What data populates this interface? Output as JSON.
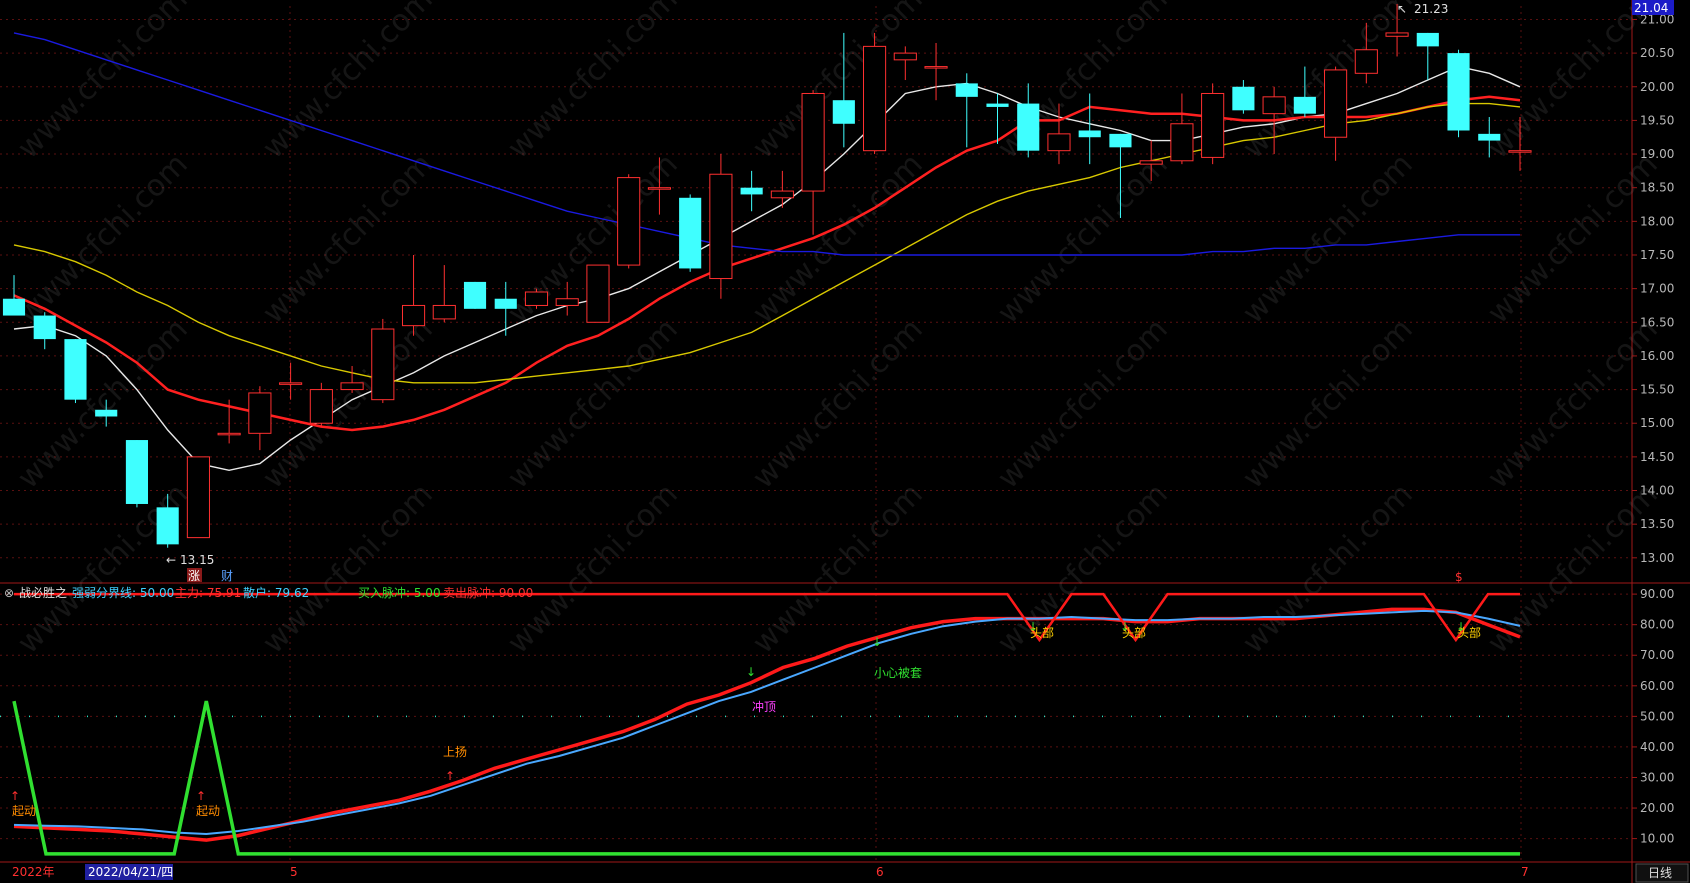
{
  "watermark": "www.cfchi.com",
  "price_right_badge": "21.04",
  "high_marker": "21.23",
  "low_marker": "13.15",
  "price_markers": [
    "涨",
    "财"
  ],
  "indicator_header": {
    "name": "战必胜之",
    "fields": [
      {
        "label": "强弱分界线: 50.00",
        "color": "#40d0ff"
      },
      {
        "label": "主力: 75.91",
        "color": "#ff3030"
      },
      {
        "label": "散户: 79.62",
        "color": "#40d0ff"
      },
      {
        "label": "买入脉冲: 5.00",
        "color": "#30e030"
      },
      {
        "label": "卖出脉冲: 90.00",
        "color": "#ff3030"
      }
    ]
  },
  "signal_labels": [
    {
      "text": "起动",
      "color": "#ff8c00"
    },
    {
      "text": "起动",
      "color": "#ff8c00"
    },
    {
      "text": "上扬",
      "color": "#ff8c00"
    },
    {
      "text": "冲顶",
      "color": "#ff40ff"
    },
    {
      "text": "小心被套",
      "color": "#30e030"
    },
    {
      "text": "头部",
      "color": "#ffd000"
    },
    {
      "text": "头部",
      "color": "#ffd000"
    },
    {
      "text": "头部",
      "color": "#ffd000"
    }
  ],
  "dollar_marker": "$",
  "x_axis": {
    "labels": [
      "2022年",
      "2022/04/21/四",
      "5",
      "6",
      "7"
    ],
    "period_button": "日线"
  },
  "chart_data": [
    {
      "type": "candlestick",
      "ylim": [
        12.7,
        21.2
      ],
      "y_ticks": [
        "21.00",
        "20.50",
        "20.00",
        "19.50",
        "19.00",
        "18.50",
        "18.00",
        "17.50",
        "17.00",
        "16.50",
        "16.00",
        "15.50",
        "15.00",
        "14.50",
        "14.00",
        "13.50",
        "13.00"
      ],
      "candles": [
        {
          "o": 16.85,
          "h": 17.2,
          "l": 16.6,
          "c": 16.6
        },
        {
          "o": 16.6,
          "h": 16.65,
          "l": 16.1,
          "c": 16.25
        },
        {
          "o": 16.25,
          "h": 16.25,
          "l": 15.3,
          "c": 15.35
        },
        {
          "o": 15.2,
          "h": 15.35,
          "l": 14.95,
          "c": 15.1
        },
        {
          "o": 14.75,
          "h": 14.75,
          "l": 13.75,
          "c": 13.8
        },
        {
          "o": 13.75,
          "h": 13.95,
          "l": 13.15,
          "c": 13.2
        },
        {
          "o": 13.3,
          "h": 14.5,
          "l": 13.3,
          "c": 14.5
        },
        {
          "o": 14.85,
          "h": 15.35,
          "l": 14.7,
          "c": 14.85
        },
        {
          "o": 14.85,
          "h": 15.55,
          "l": 14.6,
          "c": 15.45
        },
        {
          "o": 15.6,
          "h": 15.9,
          "l": 15.35,
          "c": 15.6
        },
        {
          "o": 15.0,
          "h": 15.6,
          "l": 14.95,
          "c": 15.5
        },
        {
          "o": 15.5,
          "h": 15.85,
          "l": 15.45,
          "c": 15.6
        },
        {
          "o": 15.35,
          "h": 16.55,
          "l": 15.3,
          "c": 16.4
        },
        {
          "o": 16.45,
          "h": 17.5,
          "l": 16.3,
          "c": 16.75
        },
        {
          "o": 16.55,
          "h": 17.35,
          "l": 16.5,
          "c": 16.75
        },
        {
          "o": 17.1,
          "h": 17.1,
          "l": 16.7,
          "c": 16.7
        },
        {
          "o": 16.85,
          "h": 17.1,
          "l": 16.3,
          "c": 16.7
        },
        {
          "o": 16.75,
          "h": 17.0,
          "l": 16.7,
          "c": 16.95
        },
        {
          "o": 16.75,
          "h": 17.1,
          "l": 16.6,
          "c": 16.85
        },
        {
          "o": 16.5,
          "h": 17.35,
          "l": 16.5,
          "c": 17.35
        },
        {
          "o": 17.35,
          "h": 18.7,
          "l": 17.3,
          "c": 18.65
        },
        {
          "o": 18.5,
          "h": 18.95,
          "l": 18.1,
          "c": 18.5
        },
        {
          "o": 18.35,
          "h": 18.4,
          "l": 17.25,
          "c": 17.3
        },
        {
          "o": 17.15,
          "h": 19.0,
          "l": 16.85,
          "c": 18.7
        },
        {
          "o": 18.5,
          "h": 18.75,
          "l": 18.15,
          "c": 18.4
        },
        {
          "o": 18.35,
          "h": 18.75,
          "l": 18.2,
          "c": 18.45
        },
        {
          "o": 18.45,
          "h": 19.95,
          "l": 17.8,
          "c": 19.9
        },
        {
          "o": 19.8,
          "h": 20.8,
          "l": 19.1,
          "c": 19.45
        },
        {
          "o": 19.05,
          "h": 20.8,
          "l": 19.0,
          "c": 20.6
        },
        {
          "o": 20.4,
          "h": 20.6,
          "l": 20.1,
          "c": 20.5
        },
        {
          "o": 20.3,
          "h": 20.65,
          "l": 19.8,
          "c": 20.3
        },
        {
          "o": 20.05,
          "h": 20.2,
          "l": 19.1,
          "c": 19.85
        },
        {
          "o": 19.75,
          "h": 19.9,
          "l": 19.15,
          "c": 19.7
        },
        {
          "o": 19.75,
          "h": 20.05,
          "l": 18.95,
          "c": 19.05
        },
        {
          "o": 19.05,
          "h": 19.75,
          "l": 18.85,
          "c": 19.3
        },
        {
          "o": 19.35,
          "h": 19.9,
          "l": 18.85,
          "c": 19.25
        },
        {
          "o": 19.3,
          "h": 19.3,
          "l": 18.05,
          "c": 19.1
        },
        {
          "o": 18.85,
          "h": 19.2,
          "l": 18.6,
          "c": 18.9
        },
        {
          "o": 18.9,
          "h": 19.9,
          "l": 18.85,
          "c": 19.45
        },
        {
          "o": 18.95,
          "h": 20.05,
          "l": 18.85,
          "c": 19.9
        },
        {
          "o": 20.0,
          "h": 20.1,
          "l": 19.6,
          "c": 19.65
        },
        {
          "o": 19.6,
          "h": 20.0,
          "l": 19.0,
          "c": 19.85
        },
        {
          "o": 19.85,
          "h": 20.3,
          "l": 19.55,
          "c": 19.6
        },
        {
          "o": 19.25,
          "h": 20.3,
          "l": 18.9,
          "c": 20.25
        },
        {
          "o": 20.2,
          "h": 20.95,
          "l": 20.05,
          "c": 20.55
        },
        {
          "o": 20.75,
          "h": 21.23,
          "l": 20.45,
          "c": 20.8
        },
        {
          "o": 20.8,
          "h": 20.8,
          "l": 20.1,
          "c": 20.6
        },
        {
          "o": 20.5,
          "h": 20.55,
          "l": 19.25,
          "c": 19.35
        },
        {
          "o": 19.3,
          "h": 19.55,
          "l": 18.95,
          "c": 19.2
        },
        {
          "o": 19.05,
          "h": 19.55,
          "l": 18.75,
          "c": 19.05
        }
      ],
      "series": [
        {
          "color": "#e8e8e8",
          "values": [
            16.4,
            16.45,
            16.3,
            16.0,
            15.5,
            14.9,
            14.4,
            14.3,
            14.4,
            14.75,
            15.05,
            15.35,
            15.55,
            15.75,
            16.0,
            16.2,
            16.4,
            16.6,
            16.75,
            16.85,
            17.0,
            17.25,
            17.5,
            17.75,
            18.0,
            18.25,
            18.6,
            19.0,
            19.45,
            19.9,
            20.0,
            20.05,
            19.9,
            19.7,
            19.55,
            19.45,
            19.35,
            19.2,
            19.2,
            19.3,
            19.4,
            19.45,
            19.55,
            19.6,
            19.75,
            19.9,
            20.1,
            20.3,
            20.2,
            20.0
          ]
        },
        {
          "color": "#ff2020",
          "values": [
            16.9,
            16.7,
            16.45,
            16.2,
            15.9,
            15.5,
            15.35,
            15.25,
            15.15,
            15.05,
            14.95,
            14.9,
            14.95,
            15.05,
            15.2,
            15.4,
            15.6,
            15.9,
            16.15,
            16.3,
            16.55,
            16.85,
            17.1,
            17.3,
            17.45,
            17.6,
            17.75,
            17.95,
            18.2,
            18.5,
            18.8,
            19.05,
            19.2,
            19.5,
            19.5,
            19.7,
            19.65,
            19.6,
            19.6,
            19.55,
            19.5,
            19.5,
            19.55,
            19.55,
            19.55,
            19.6,
            19.7,
            19.8,
            19.85,
            19.8
          ]
        },
        {
          "color": "#d8c800",
          "values": [
            17.65,
            17.55,
            17.4,
            17.2,
            16.95,
            16.75,
            16.5,
            16.3,
            16.15,
            16.0,
            15.85,
            15.75,
            15.65,
            15.6,
            15.6,
            15.6,
            15.65,
            15.7,
            15.75,
            15.8,
            15.85,
            15.95,
            16.05,
            16.2,
            16.35,
            16.6,
            16.85,
            17.1,
            17.35,
            17.6,
            17.85,
            18.1,
            18.3,
            18.45,
            18.55,
            18.65,
            18.8,
            18.9,
            19.0,
            19.1,
            19.2,
            19.25,
            19.35,
            19.45,
            19.5,
            19.6,
            19.7,
            19.75,
            19.75,
            19.7
          ]
        },
        {
          "color": "#1a1ae0",
          "values": [
            20.8,
            20.7,
            20.55,
            20.4,
            20.25,
            20.1,
            19.95,
            19.8,
            19.65,
            19.5,
            19.35,
            19.2,
            19.05,
            18.9,
            18.75,
            18.6,
            18.45,
            18.3,
            18.15,
            18.05,
            17.95,
            17.85,
            17.75,
            17.65,
            17.6,
            17.55,
            17.55,
            17.5,
            17.5,
            17.5,
            17.5,
            17.5,
            17.5,
            17.5,
            17.5,
            17.5,
            17.5,
            17.5,
            17.5,
            17.55,
            17.55,
            17.6,
            17.6,
            17.65,
            17.65,
            17.7,
            17.75,
            17.8,
            17.8,
            17.8
          ]
        }
      ]
    },
    {
      "type": "line",
      "ylim": [
        3,
        92
      ],
      "y_ticks": [
        "90.00",
        "80.00",
        "70.00",
        "60.00",
        "50.00",
        "40.00",
        "30.00",
        "20.00",
        "10.00"
      ],
      "threshold": 50,
      "series": [
        {
          "name": "主力",
          "color": "#ff1a1a",
          "values": [
            14,
            13.5,
            13,
            12.5,
            11.5,
            10.5,
            9.5,
            11,
            13.5,
            16,
            18.5,
            20.5,
            22.5,
            25.5,
            29,
            33,
            36,
            39,
            42,
            45,
            49,
            54,
            57,
            61,
            66,
            69,
            73,
            76,
            79,
            81,
            82,
            82,
            82,
            82,
            82,
            81,
            81,
            82,
            82,
            82,
            82,
            83,
            84,
            85,
            85,
            84,
            80,
            76
          ]
        },
        {
          "name": "散户",
          "color": "#4aa8ff",
          "values": [
            14.5,
            14.2,
            14,
            13.5,
            13,
            12,
            11.5,
            12.5,
            14,
            15.5,
            17.5,
            19.5,
            21.5,
            24,
            27.5,
            31,
            34.5,
            37,
            40,
            43,
            47,
            51,
            55,
            58,
            62,
            66,
            70,
            74,
            77,
            79.5,
            81,
            82,
            82,
            82.5,
            82,
            81.5,
            81.5,
            82,
            82,
            82.5,
            82.5,
            83,
            83.5,
            84,
            84.5,
            84,
            82,
            79.6
          ]
        },
        {
          "name": "卖出脉冲",
          "color": "#ff1a1a",
          "values": [
            90,
            90,
            90,
            90,
            90,
            90,
            90,
            90,
            90,
            90,
            90,
            90,
            90,
            90,
            90,
            90,
            90,
            90,
            90,
            90,
            90,
            90,
            90,
            90,
            90,
            90,
            90,
            90,
            90,
            90,
            90,
            90,
            75,
            90,
            90,
            75,
            90,
            90,
            90,
            90,
            90,
            90,
            90,
            90,
            90,
            75,
            90,
            90
          ]
        },
        {
          "name": "买入脉冲",
          "color": "#30e030",
          "values": [
            55,
            5,
            5,
            5,
            5,
            5,
            55,
            5,
            5,
            5,
            5,
            5,
            5,
            5,
            5,
            5,
            5,
            5,
            5,
            5,
            5,
            5,
            5,
            5,
            5,
            5,
            5,
            5,
            5,
            5,
            5,
            5,
            5,
            5,
            5,
            5,
            5,
            5,
            5,
            5,
            5,
            5,
            5,
            5,
            5,
            5,
            5,
            5
          ]
        }
      ]
    }
  ]
}
